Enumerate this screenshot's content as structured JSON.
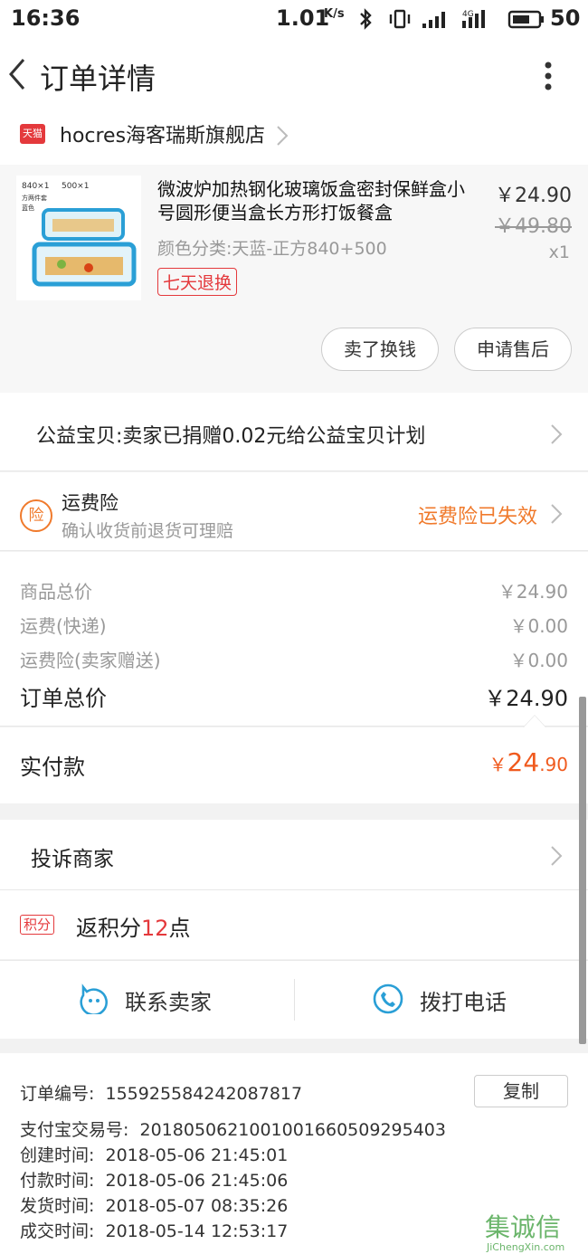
{
  "status_bar": {
    "time": "16:36",
    "speed": "1.01",
    "speed_unit": "K/s",
    "network": "4G",
    "battery": "50"
  },
  "nav": {
    "title": "订单详情"
  },
  "store": {
    "badge": "天猫",
    "name": "hocres海客瑞斯旗舰店"
  },
  "product": {
    "name": "微波炉加热钢化玻璃饭盒密封保鲜盒小号圆形便当盒长方形打饭餐盒",
    "price": "￥24.90",
    "original_price": "￥49.80",
    "quantity": "x1",
    "variant": "颜色分类:天蓝-正方840+500",
    "badge": "七天退换",
    "thumb_labels": [
      "840×1",
      "500×1",
      "方两件套",
      "蓝色"
    ],
    "buttons": {
      "resell": "卖了换钱",
      "after_sale": "申请售后"
    }
  },
  "charity": {
    "text": "公益宝贝:卖家已捐赠0.02元给公益宝贝计划"
  },
  "insurance": {
    "icon_text": "险",
    "title": "运费险",
    "subtitle": "确认收货前退货可理赔",
    "status": "运费险已失效"
  },
  "totals": {
    "rows": [
      {
        "label": "商品总价",
        "value": "￥24.90"
      },
      {
        "label": "运费(快递)",
        "value": "￥0.00"
      },
      {
        "label": "运费险(卖家赠送)",
        "value": "￥0.00"
      }
    ],
    "order_total_label": "订单总价",
    "order_total_value": "￥24.90"
  },
  "paid": {
    "label": "实付款",
    "currency": "￥",
    "integer": "24",
    "decimal": ".90"
  },
  "complain": {
    "label": "投诉商家"
  },
  "points": {
    "badge": "积分",
    "prefix": "返积分",
    "num": "12",
    "suffix": "点"
  },
  "contact": {
    "seller": "联系卖家",
    "call": "拨打电话"
  },
  "order_info": {
    "order_no_label": "订单编号:",
    "order_no": "155925584242087817",
    "copy": "复制",
    "lines": [
      {
        "label": "支付宝交易号:",
        "value": "2018050621001001660509295403"
      },
      {
        "label": "创建时间:",
        "value": "2018-05-06 21:45:01"
      },
      {
        "label": "付款时间:",
        "value": "2018-05-06 21:45:06"
      },
      {
        "label": "发货时间:",
        "value": "2018-05-07 08:35:26"
      },
      {
        "label": "成交时间:",
        "value": "2018-05-14 12:53:17"
      }
    ]
  },
  "watermark": {
    "text": "集诚信",
    "url": "JiChengXin.com"
  },
  "colors": {
    "accent_orange": "#f07a2c",
    "tmall_red": "#e4393c",
    "paid_orange": "#f05a1e"
  }
}
